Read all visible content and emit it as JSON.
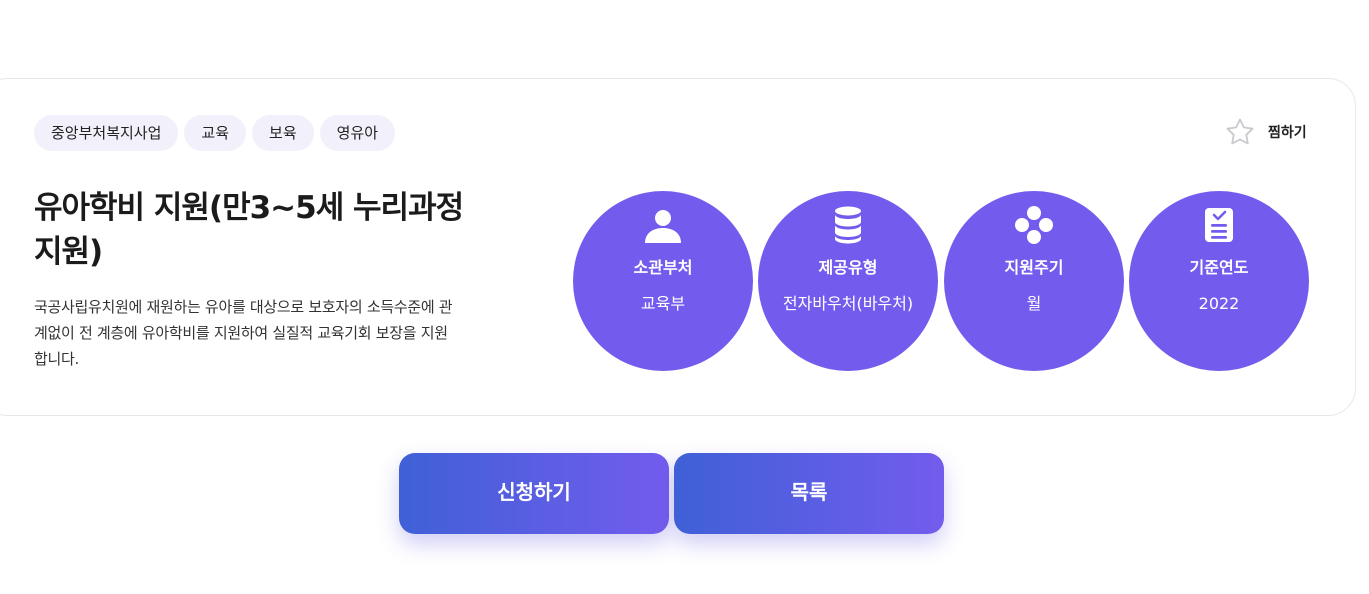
{
  "tags": [
    "중앙부처복지사업",
    "교육",
    "보육",
    "영유아"
  ],
  "favorite": {
    "label": "찜하기",
    "icon": "star-icon"
  },
  "title": "유아학비 지원(만3~5세 누리과정 지원)",
  "description": "국공사립유치원에 재원하는 유아를 대상으로 보호자의 소득수준에 관계없이 전 계층에 유아학비를 지원하여 실질적 교육기회 보장을 지원합니다.",
  "info": [
    {
      "icon": "person-icon",
      "label": "소관부처",
      "value": "교육부"
    },
    {
      "icon": "database-icon",
      "label": "제공유형",
      "value": "전자바우처(바우처)"
    },
    {
      "icon": "cycle-icon",
      "label": "지원주기",
      "value": "월"
    },
    {
      "icon": "document-icon",
      "label": "기준연도",
      "value": "2022"
    }
  ],
  "buttons": {
    "apply": "신청하기",
    "list": "목록"
  },
  "colors": {
    "accent": "#735ced",
    "gradient_start": "#3f60d7",
    "tag_bg": "#f1f0fb"
  }
}
